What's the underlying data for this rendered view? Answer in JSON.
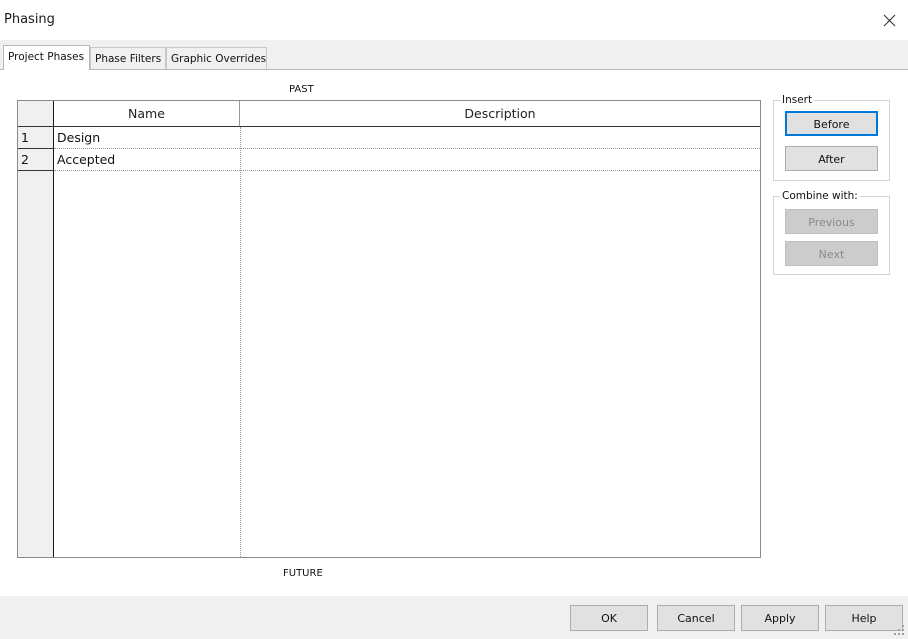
{
  "window": {
    "title": "Phasing"
  },
  "tabs": [
    {
      "label": "Project Phases",
      "active": true
    },
    {
      "label": "Phase Filters",
      "active": false
    },
    {
      "label": "Graphic Overrides",
      "active": false
    }
  ],
  "grid": {
    "top_label": "PAST",
    "bottom_label": "FUTURE",
    "columns": [
      "Name",
      "Description"
    ],
    "rows": [
      {
        "num": "1",
        "name": "Design",
        "description": ""
      },
      {
        "num": "2",
        "name": "Accepted",
        "description": ""
      }
    ]
  },
  "insert_group": {
    "label": "Insert",
    "before": "Before",
    "after": "After"
  },
  "combine_group": {
    "label": "Combine with:",
    "previous": "Previous",
    "next": "Next"
  },
  "footer": {
    "ok": "OK",
    "cancel": "Cancel",
    "apply": "Apply",
    "help": "Help"
  },
  "icons": {
    "close": "close-icon",
    "resize": "resize-grip-icon"
  },
  "colors": {
    "accent": "#0078d7",
    "button_face": "#e1e1e1",
    "disabled_face": "#cccccc"
  }
}
